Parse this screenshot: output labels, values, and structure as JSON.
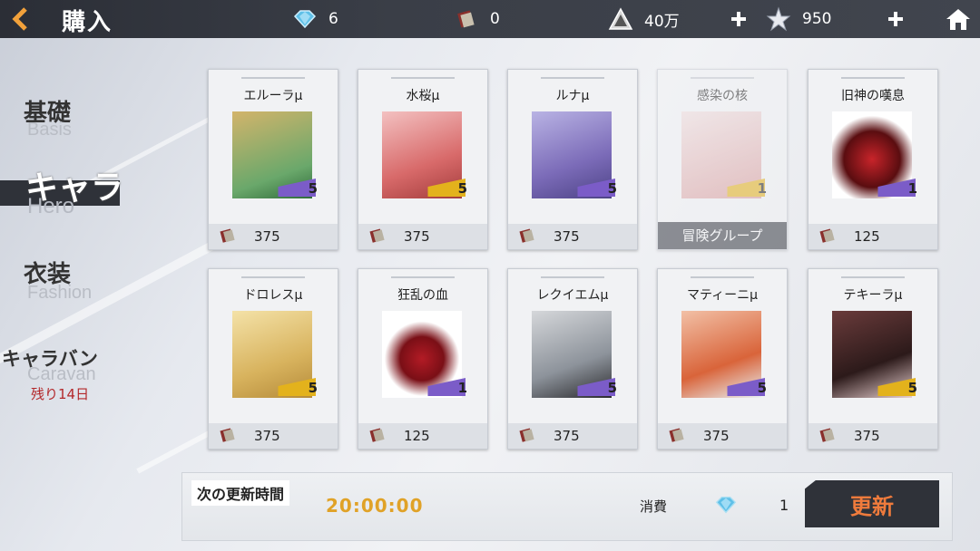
{
  "header": {
    "title": "購入",
    "crystals": "6",
    "tickets": "0",
    "coins": "40万",
    "stars": "950"
  },
  "sidebar": {
    "items": [
      {
        "label": "基礎",
        "sub": "Basis"
      },
      {
        "label": "キャラ",
        "sub": "Hero"
      },
      {
        "label": "衣装",
        "sub": "Fashion"
      },
      {
        "label": "キャラバン",
        "sub": "Caravan",
        "note": "残り14日"
      }
    ]
  },
  "cards": [
    {
      "name": "エルーラμ",
      "level": "5",
      "price": "375",
      "accent": "#7b5cc8"
    },
    {
      "name": "水桜μ",
      "level": "5",
      "price": "375",
      "accent": "#e3b21c"
    },
    {
      "name": "ルナμ",
      "level": "5",
      "price": "375",
      "accent": "#7b5cc8"
    },
    {
      "name": "感染の核",
      "level": "1",
      "group": "冒険グループ",
      "accent": "#e3b21c"
    },
    {
      "name": "旧神の嘆息",
      "level": "1",
      "price": "125",
      "accent": "#7b5cc8"
    },
    {
      "name": "ドロレスμ",
      "level": "5",
      "price": "375",
      "accent": "#e3b21c"
    },
    {
      "name": "狂乱の血",
      "level": "1",
      "price": "125",
      "accent": "#7b5cc8"
    },
    {
      "name": "レクイエムμ",
      "level": "5",
      "price": "375",
      "accent": "#7b5cc8"
    },
    {
      "name": "マティーニμ",
      "level": "5",
      "price": "375",
      "accent": "#7b5cc8"
    },
    {
      "name": "テキーラμ",
      "level": "5",
      "price": "375",
      "accent": "#e3b21c"
    }
  ],
  "footer": {
    "next_refresh_label": "次の更新時間",
    "timer": "20:00:00",
    "cost_label": "消費",
    "cost_value": "1",
    "refresh_label": "更新"
  }
}
